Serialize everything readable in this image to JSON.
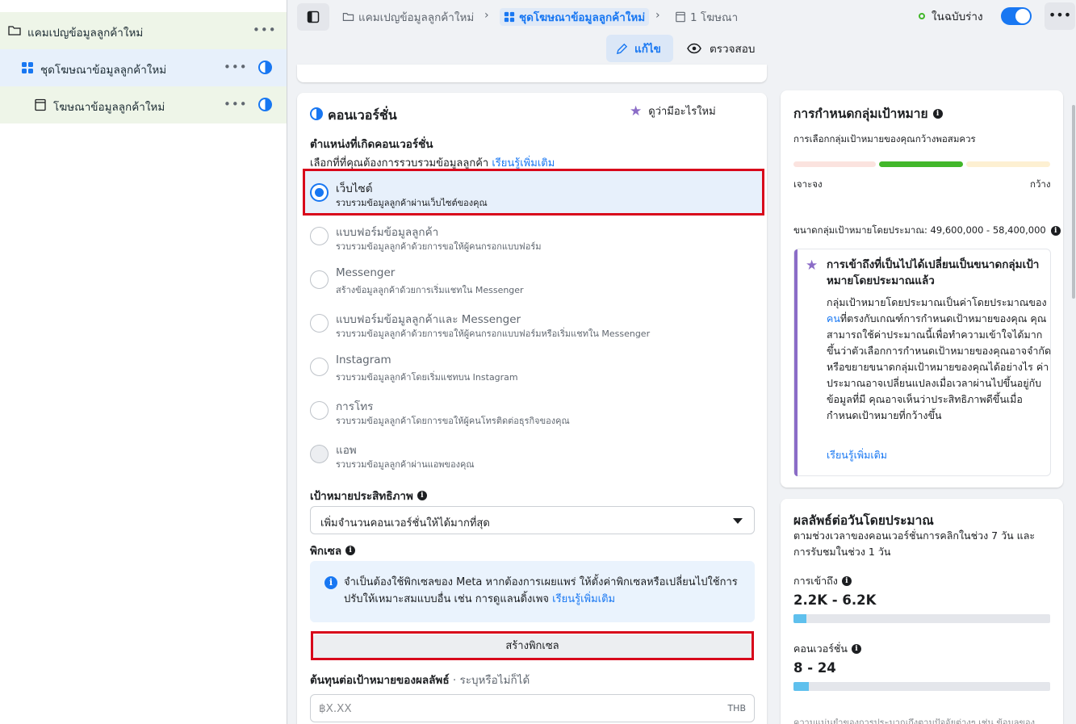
{
  "sidebar": {
    "campaign": {
      "label": "แคมเปญข้อมูลลูกค้าใหม่"
    },
    "adset": {
      "label": "ชุดโฆษณาข้อมูลลูกค้าใหม่"
    },
    "ad": {
      "label": "โฆษณาข้อมูลลูกค้าใหม่"
    }
  },
  "topbar": {
    "crumb_campaign": "แคมเปญข้อมูลลูกค้าใหม่",
    "crumb_adset": "ชุดโฆษณาข้อมูลลูกค้าใหม่",
    "crumb_ad": "1 โฆษณา",
    "status": "ในฉบับร่าง",
    "toggle_on": true,
    "edit_label": "แก้ไข",
    "review_label": "ตรวจสอบ"
  },
  "conversion": {
    "title": "คอนเวอร์ชั่น",
    "whats_new": "ดูว่ามีอะไรใหม่",
    "location_heading": "ตำแหน่งที่เกิดคอนเวอร์ชั่น",
    "location_desc": "เลือกที่ที่คุณต้องการรวบรวมข้อมูลลูกค้า",
    "learn_more": "เรียนรู้เพิ่มเติม",
    "options": [
      {
        "label": "เว็บไซต์",
        "desc": "รวบรวมข้อมูลลูกค้าผ่านเว็บไซต์ของคุณ",
        "selected": true
      },
      {
        "label": "แบบฟอร์มข้อมูลลูกค้า",
        "desc": "รวบรวมข้อมูลลูกค้าด้วยการขอให้ผู้คนกรอกแบบฟอร์ม"
      },
      {
        "label": "Messenger",
        "desc": "สร้างข้อมูลลูกค้าด้วยการเริ่มแชทใน Messenger"
      },
      {
        "label": "แบบฟอร์มข้อมูลลูกค้าและ Messenger",
        "desc": "รวบรวมข้อมูลลูกค้าด้วยการขอให้ผู้คนกรอกแบบฟอร์มหรือเริ่มแชทใน Messenger"
      },
      {
        "label": "Instagram",
        "desc": "รวบรวมข้อมูลลูกค้าโดยเริ่มแชทบน Instagram"
      },
      {
        "label": "การโทร",
        "desc": "รวบรวมข้อมูลลูกค้าโดยการขอให้ผู้คนโทรติดต่อธุรกิจของคุณ"
      },
      {
        "label": "แอพ",
        "desc": "รวบรวมข้อมูลลูกค้าผ่านแอพของคุณ",
        "disabled": true
      }
    ],
    "goal_heading": "เป้าหมายประสิทธิภาพ",
    "goal_value": "เพิ่มจำนวนคอนเวอร์ชั่นให้ได้มากที่สุด",
    "pixel_heading": "พิกเซล",
    "pixel_notice": "จำเป็นต้องใช้พิกเซลของ Meta หากต้องการเผยแพร่ ให้ตั้งค่าพิกเซลหรือเปลี่ยนไปใช้การปรับให้เหมาะสมแบบอื่น เช่น การดูแลนดิ้งเพจ",
    "pixel_learn_more": "เรียนรู้เพิ่มเติม",
    "create_pixel": "สร้างพิกเซล",
    "bid_label": "ต้นทุนต่อเป้าหมายของผลลัพธ์",
    "bid_optional": "· ระบุหรือไม่ก็ได้",
    "bid_placeholder": "฿X.XX",
    "bid_currency": "THB"
  },
  "audience": {
    "title": "การกำหนดกลุ่มเป้าหมาย",
    "subtitle": "การเลือกกลุ่มเป้าหมายของคุณกว้างพอสมควร",
    "specific": "เจาะจง",
    "broad": "กว้าง",
    "size_label": "ขนาดกลุ่มเป้าหมายโดยประมาณ: 49,600,000 - 58,400,000",
    "notice_title": "การเข้าถึงที่เป็นไปได้เปลี่ยนเป็นขนาดกลุ่มเป้าหมายโดยประมาณแล้ว",
    "notice_body_1": "กลุ่มเป้าหมายโดยประมาณเป็นค่าโดยประมาณของ",
    "notice_body_link": "คน",
    "notice_body_2": "ที่ตรงกับเกณฑ์การกำหนดเป้าหมายของคุณ คุณสามารถใช้ค่าประมาณนี้เพื่อทำความเข้าใจได้มากขึ้นว่าตัวเลือกการกำหนดเป้าหมายของคุณอาจจำกัดหรือขยายขนาดกลุ่มเป้าหมายของคุณได้อย่างไร ค่าประมาณอาจเปลี่ยนแปลงเมื่อเวลาผ่านไปขึ้นอยู่กับข้อมูลที่มี คุณอาจเห็นว่าประสิทธิภาพดีขึ้นเมื่อกำหนดเป้าหมายที่กว้างขึ้น",
    "notice_learn_more": "เรียนรู้เพิ่มเติม"
  },
  "results": {
    "title": "ผลลัพธ์ต่อวันโดยประมาณ",
    "subtitle_1": "ตามช่วงเวลาของคอนเวอร์ชั่นการคลิกในช่วง 7 วัน และ",
    "subtitle_2": "การรับชมในช่วง 1 วัน",
    "reach_label": "การเข้าถึง",
    "reach_value": "2.2K - 6.2K",
    "reach_fill": 0.05,
    "conv_label": "คอนเวอร์ชั่น",
    "conv_value": "8 - 24",
    "conv_fill": 0.06,
    "footer": "ความแม่นยำของการประมาณถึงตามปัจจัยต่างๆ เช่น ข้อมูลของ"
  },
  "colors": {
    "accent": "#1877f2",
    "highlight": "#d8071b",
    "purple": "#8b6cc7"
  }
}
